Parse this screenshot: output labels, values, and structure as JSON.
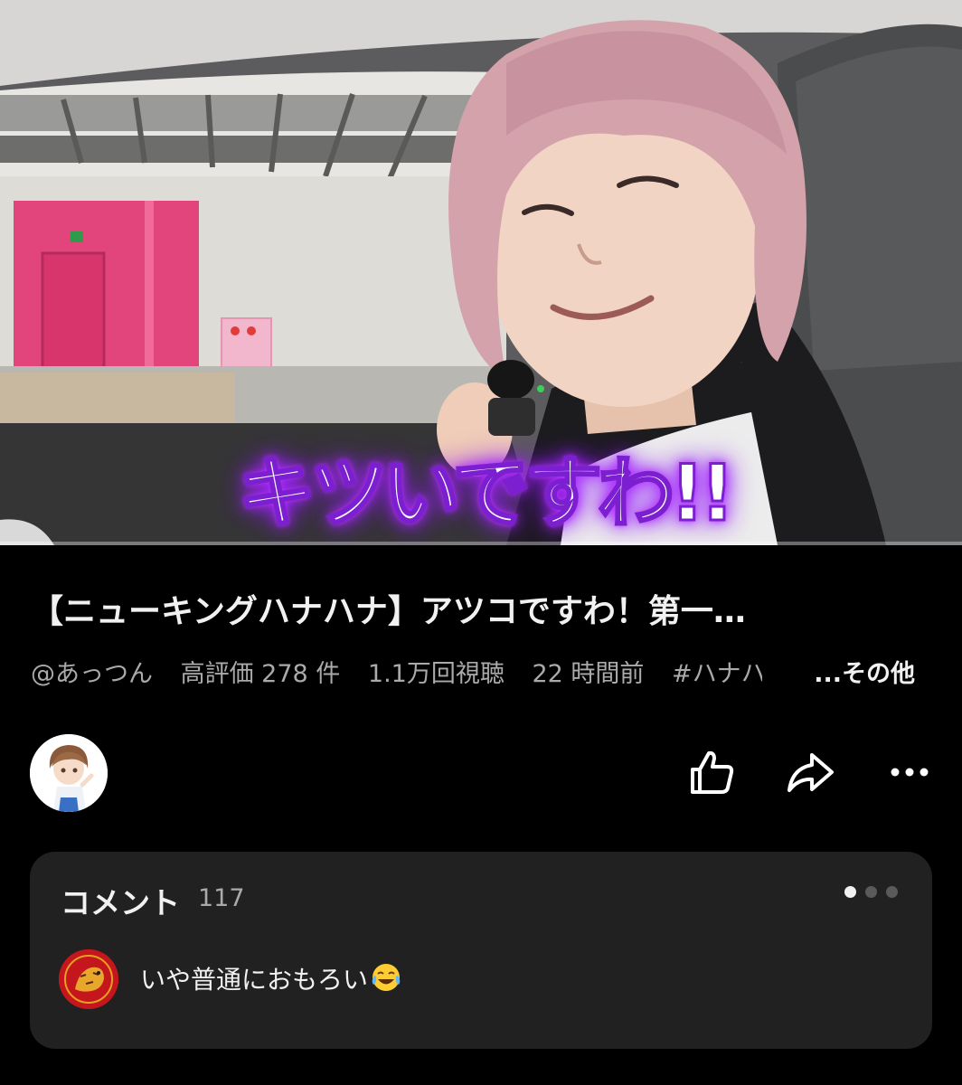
{
  "video": {
    "caption": "キツいですわ!!",
    "progress": 0,
    "colors": {
      "caption_glow": "#b02cff",
      "progress_fill": "#ff0000"
    }
  },
  "title": "【ニューキングハナハナ】アツコですわ！第一…",
  "meta": {
    "channel_handle": "@あっつん",
    "likes": "高評価 278 件",
    "views": "1.1万回視聴",
    "published": "22 時間前",
    "hashtag": "#ハナハ",
    "more": "...その他"
  },
  "actions": {
    "like_icon": "thumbs-up-icon",
    "share_icon": "share-icon",
    "more_icon": "more-horizontal-icon"
  },
  "comments": {
    "label": "コメント",
    "count": "117",
    "pager": {
      "total": 3,
      "active": 0
    },
    "top_comment": {
      "text": "いや普通におもろい",
      "emoji": "face-with-tears-of-joy"
    }
  }
}
